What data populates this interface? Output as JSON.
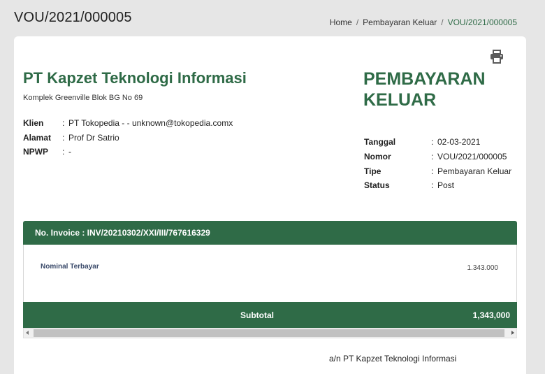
{
  "page": {
    "title": "VOU/2021/000005"
  },
  "breadcrumb": {
    "home": "Home",
    "separator": "/",
    "section": "Pembayaran Keluar",
    "current": "VOU/2021/000005"
  },
  "company": {
    "name": "PT Kapzet Teknologi Informasi",
    "address": "Komplek Greenville Blok BG No 69"
  },
  "client": [
    {
      "label": "Klien",
      "value": "PT Tokopedia - - unknown@tokopedia.comx"
    },
    {
      "label": "Alamat",
      "value": "Prof Dr Satrio"
    },
    {
      "label": "NPWP",
      "value": "-"
    }
  ],
  "document": {
    "title_line1": "PEMBAYARAN",
    "title_line2": "KELUAR",
    "meta": [
      {
        "label": "Tanggal",
        "value": "02-03-2021"
      },
      {
        "label": "Nomor",
        "value": "VOU/2021/000005"
      },
      {
        "label": "Tipe",
        "value": "Pembayaran Keluar"
      },
      {
        "label": "Status",
        "value": "Post"
      }
    ]
  },
  "invoice": {
    "header": "No. Invoice : INV/20210302/XXI/III/767616329",
    "nominal_label": "Nominal Terbayar",
    "nominal_value": "1.343.000",
    "subtotal_label": "Subtotal",
    "subtotal_value": "1,343,000"
  },
  "signature": "a/n PT Kapzet Teknologi Informasi",
  "icons": {
    "print": "printer-icon"
  },
  "colors": {
    "accent": "#2f6b47",
    "background": "#e6e6e6"
  }
}
